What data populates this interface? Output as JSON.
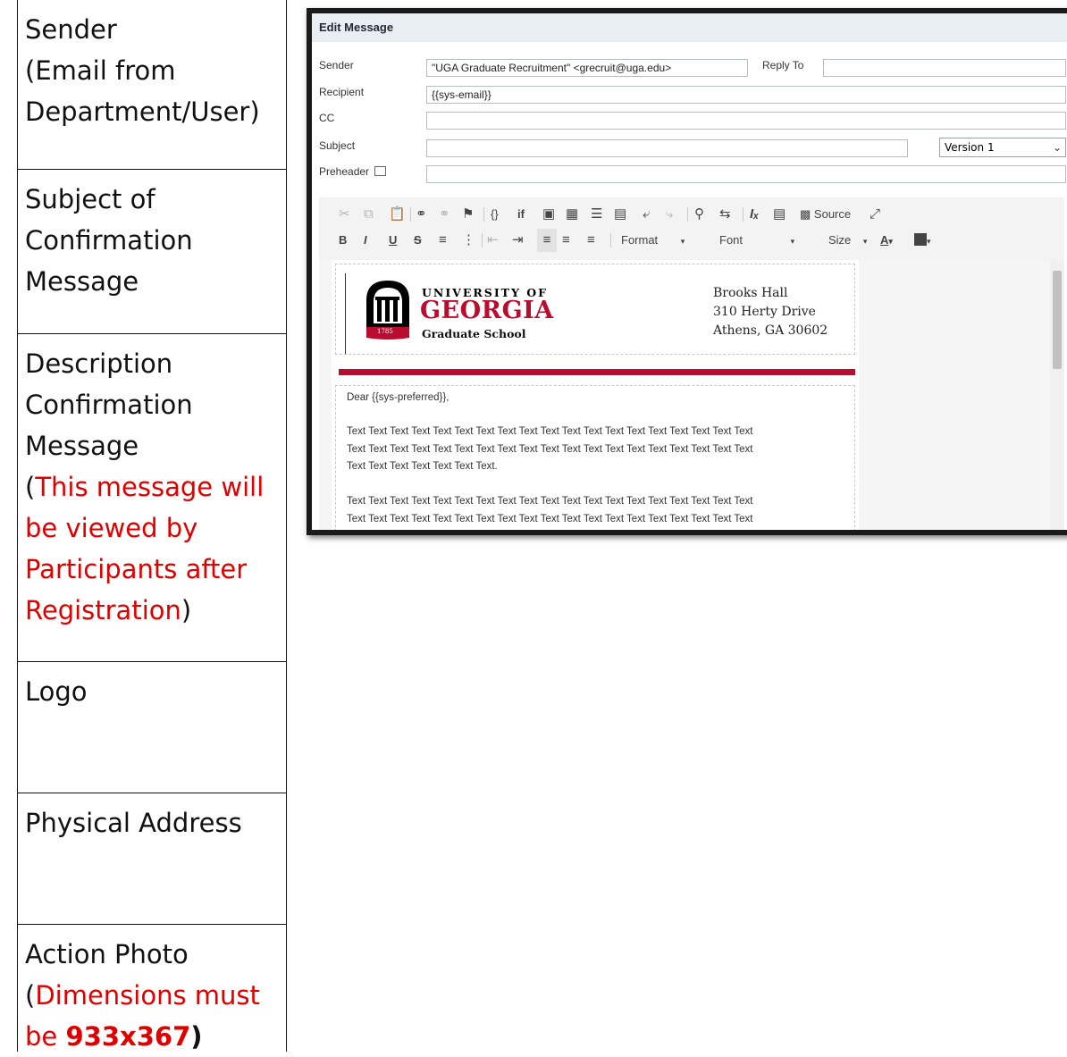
{
  "annotations": [
    {
      "segments": [
        {
          "text": "Sender"
        },
        {
          "text": "(Email from"
        },
        {
          "text": "Department/User)"
        }
      ]
    },
    {
      "segments": [
        {
          "text": "Subject of"
        },
        {
          "text": "Confirmation"
        },
        {
          "text": "Message"
        }
      ]
    },
    {
      "lines": [
        [
          "Description"
        ],
        [
          "Confirmation"
        ],
        [
          "Message"
        ],
        [
          "(",
          "This message will"
        ],
        [
          "be viewed by"
        ],
        [
          "Participants after"
        ],
        [
          "Registration",
          ")"
        ]
      ]
    },
    {
      "segments": [
        {
          "text": "Logo"
        }
      ]
    },
    {
      "segments": [
        {
          "text": "Physical Address"
        }
      ]
    },
    {
      "lines": [
        [
          "Action Photo"
        ],
        [
          "(",
          "Dimensions must"
        ],
        [
          "be ",
          "933x367",
          ")"
        ]
      ]
    }
  ],
  "editor": {
    "header": "Edit Message",
    "sender_label": "Sender",
    "sender_value": "\"UGA Graduate Recruitment\" <grecruit@uga.edu>",
    "reply_to_label": "Reply To",
    "reply_to_value": "",
    "recipient_label": "Recipient",
    "recipient_value": "{{sys-email}}",
    "cc_label": "CC",
    "cc_value": "",
    "subject_label": "Subject",
    "subject_value": "",
    "version_value": "Version 1",
    "preheader_label": "Preheader",
    "preheader_value": "",
    "toolbar": {
      "source_label": "Source",
      "format_label": "Format",
      "font_label": "Font",
      "size_label": "Size",
      "if_label": "if",
      "braces_label": "{}"
    },
    "email": {
      "logo_top": "UNIVERSITY OF",
      "logo_main": "GEORGIA",
      "logo_sub": "Graduate School",
      "logo_year": "1785",
      "address_line1": "Brooks Hall",
      "address_line2": "310 Herty Drive",
      "address_line3": "Athens, GA 30602",
      "greeting": "Dear {{sys-preferred}},",
      "para1_line1": "Text Text Text Text Text Text Text Text Text Text Text Text Text Text Text Text Text Text Text",
      "para1_line2": "Text Text Text Text Text Text Text Text Text Text Text Text Text Text Text Text Text Text Text",
      "para1_line3": "Text Text Text Text Text Text Text.",
      "para2_line1": "Text Text Text Text Text Text Text Text Text Text Text Text Text Text Text Text Text Text Text",
      "para2_line2": "Text Text Text Text Text Text Text Text Text Text Text Text Text Text Text Text Text Text Text"
    }
  },
  "colors": {
    "accent_red": "#e00000",
    "uga_red": "#ba0c2f"
  }
}
